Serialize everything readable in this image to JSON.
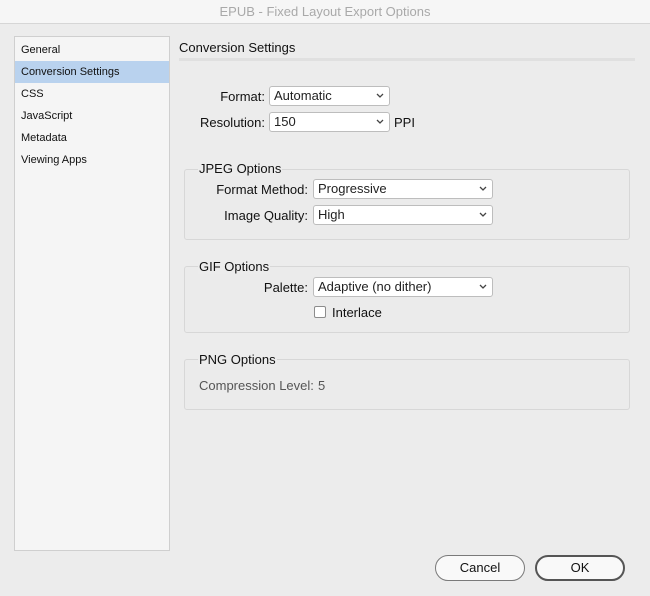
{
  "window": {
    "title": "EPUB - Fixed Layout Export Options"
  },
  "sidebar": {
    "items": [
      {
        "label": "General"
      },
      {
        "label": "Conversion Settings"
      },
      {
        "label": "CSS"
      },
      {
        "label": "JavaScript"
      },
      {
        "label": "Metadata"
      },
      {
        "label": "Viewing Apps"
      }
    ],
    "selected": "Conversion Settings"
  },
  "main": {
    "heading": "Conversion Settings",
    "format": {
      "label": "Format:",
      "value": "Automatic"
    },
    "resolution": {
      "label": "Resolution:",
      "value": "150",
      "unit": "PPI"
    },
    "jpeg": {
      "title": "JPEG Options",
      "format_method": {
        "label": "Format Method:",
        "value": "Progressive"
      },
      "image_quality": {
        "label": "Image Quality:",
        "value": "High"
      }
    },
    "gif": {
      "title": "GIF Options",
      "palette": {
        "label": "Palette:",
        "value": "Adaptive (no dither)"
      },
      "interlace": {
        "label": "Interlace",
        "checked": false
      }
    },
    "png": {
      "title": "PNG Options",
      "compression": {
        "label": "Compression Level:",
        "value": "5"
      }
    }
  },
  "footer": {
    "cancel_label": "Cancel",
    "ok_label": "OK"
  },
  "colors": {
    "selection": "#b9d2ee",
    "background": "#ececec"
  }
}
